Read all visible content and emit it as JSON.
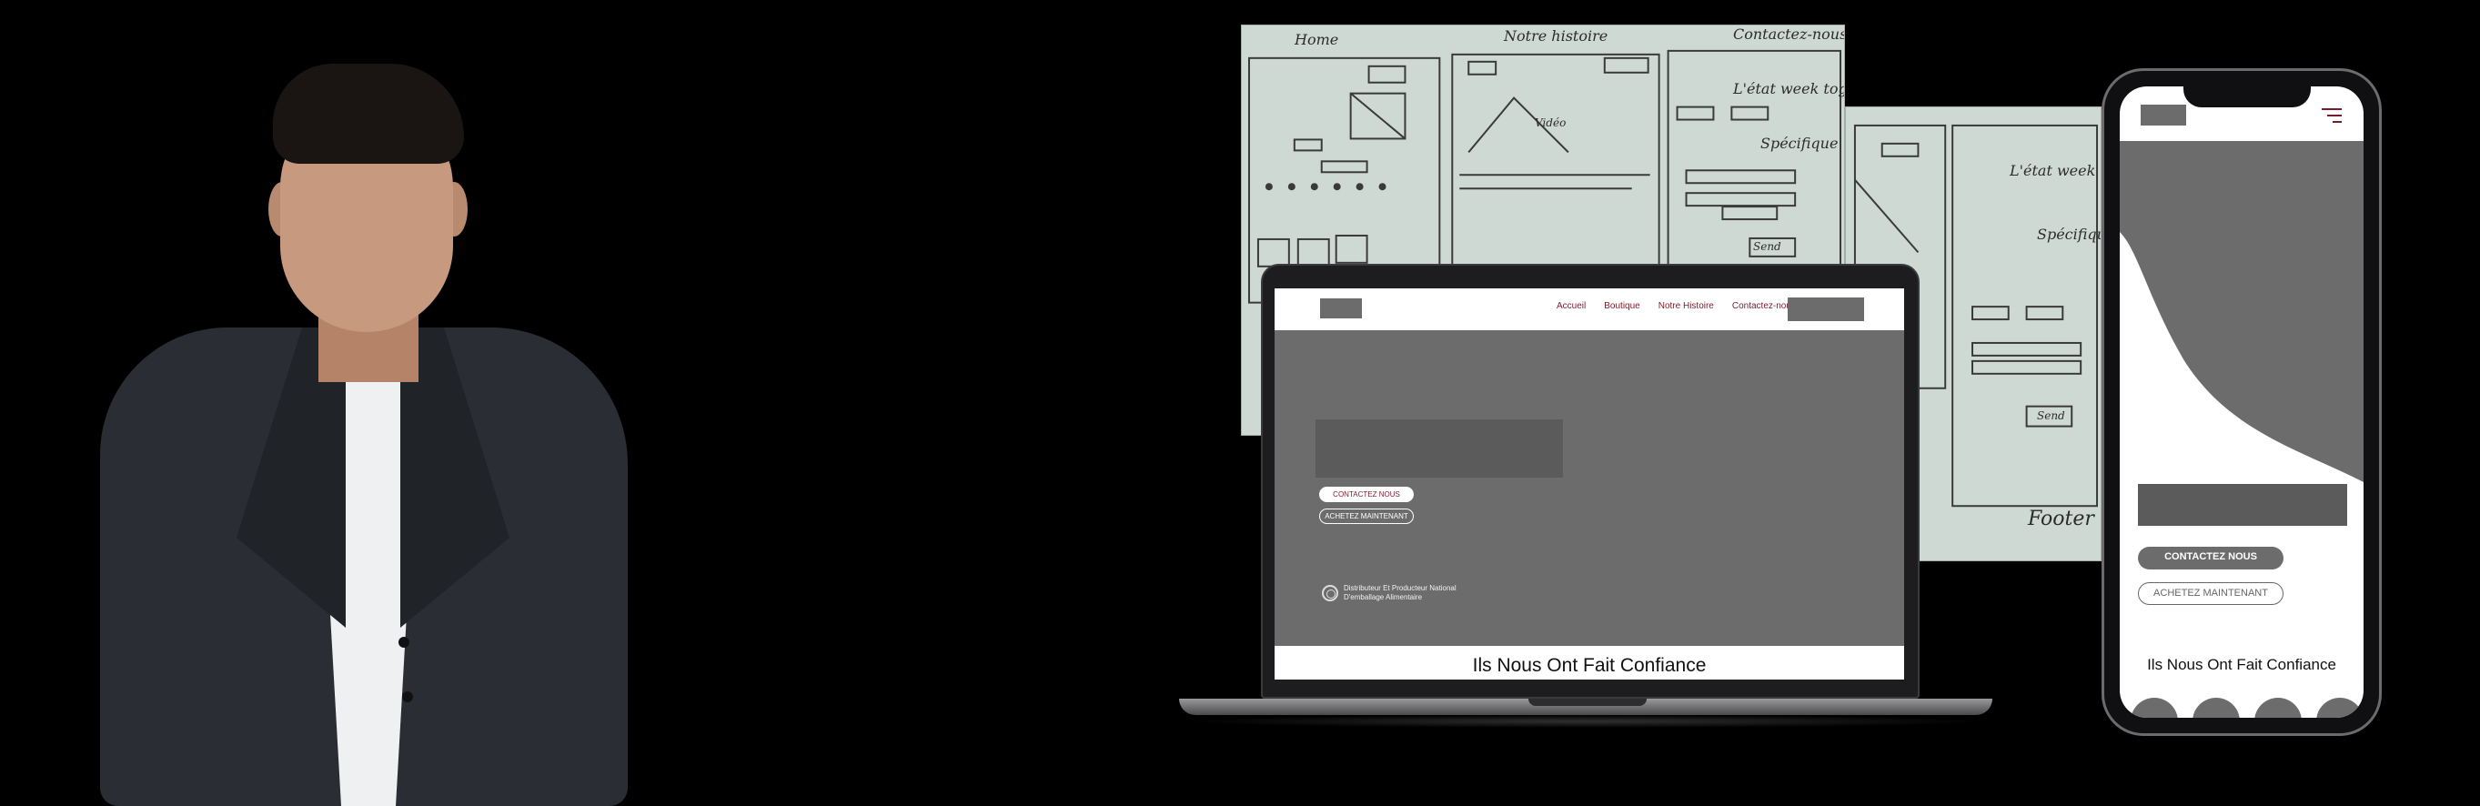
{
  "sketches": {
    "main_labels": [
      "Home",
      "Notre histoire",
      "Contactez-nous",
      "L'état week togeth",
      "Spécifique",
      "Vidéo",
      "Send"
    ],
    "right_labels": [
      "L'état week t",
      "Spécifique",
      "Send",
      "Footer"
    ]
  },
  "laptop": {
    "nav_links": [
      "Accueil",
      "Boutique",
      "Notre Histoire",
      "Contactez-nous"
    ],
    "contact_button": "CONTACTEZ NOUS",
    "buy_button": "ACHETEZ MAINTENANT",
    "badge_line1": "Distributeur Et Producteur National",
    "badge_line2": "D'emballage Alimentaire",
    "trust_heading": "Ils Nous Ont Fait Confiance"
  },
  "phone": {
    "contact_button": "CONTACTEZ NOUS",
    "buy_button": "ACHETEZ MAINTENANT",
    "trust_heading": "Ils Nous Ont Fait Confiance"
  },
  "colors": {
    "background": "#000000",
    "accent": "#7a1d2b",
    "placeholder_gray": "#6c6c6c"
  }
}
